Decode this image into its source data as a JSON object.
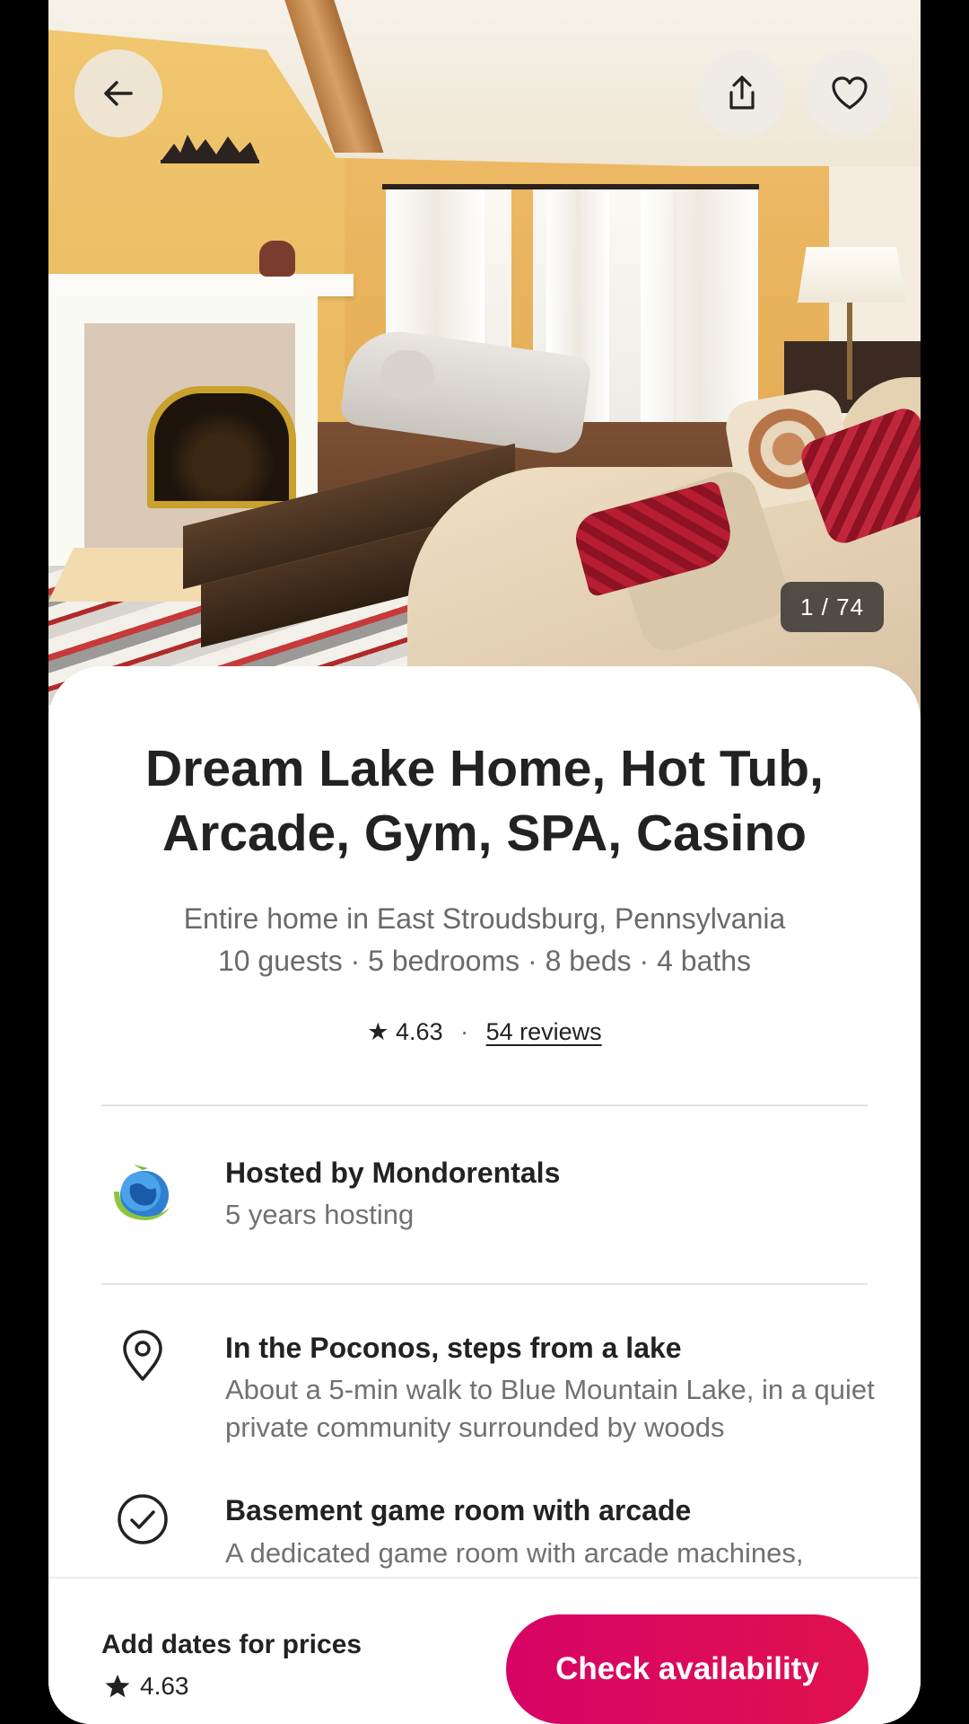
{
  "gallery": {
    "counter": "1 / 74",
    "back_icon": "arrow-left-icon",
    "share_icon": "share-icon",
    "save_icon": "heart-icon"
  },
  "listing": {
    "title": "Dream Lake Home, Hot Tub, Arcade, Gym, SPA, Casino",
    "type_location": "Entire home in East Stroudsburg, Pennsylvania",
    "capacity": "10 guests · 5 bedrooms · 8 beds · 4 baths",
    "rating": "4.63",
    "reviews": "54 reviews"
  },
  "host": {
    "title": "Hosted by Mondorentals",
    "tenure": "5 years hosting"
  },
  "highlights": [
    {
      "icon": "location-pin-icon",
      "title": "In the Poconos, steps from a lake",
      "description": "About a 5-min walk to Blue Mountain Lake, in a quiet private community surrounded by woods"
    },
    {
      "icon": "check-circle-icon",
      "title": "Basement game room with arcade",
      "description": "A dedicated game room with arcade machines,"
    }
  ],
  "footer": {
    "prompt": "Add dates for prices",
    "rating": "4.63",
    "cta": "Check availability"
  },
  "colors": {
    "brand": "#E0114E",
    "text": "#222222",
    "muted": "#717171",
    "counter_bg": "#3B3B3B"
  }
}
